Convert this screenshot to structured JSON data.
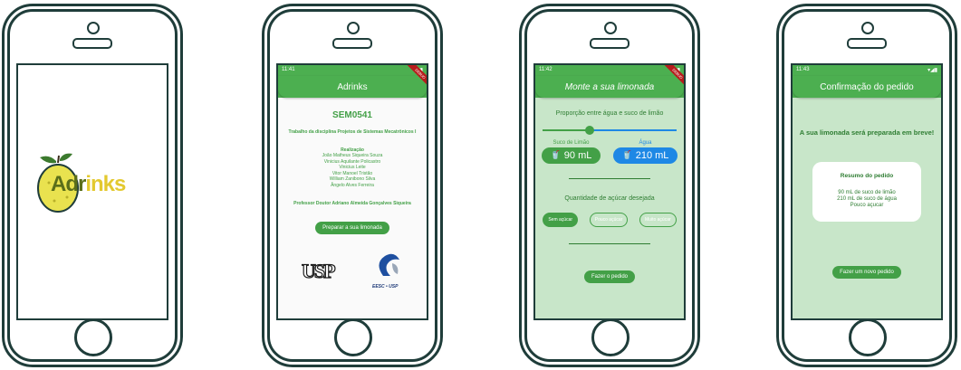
{
  "splash": {
    "logo_prefix": "Adr",
    "logo_suffix": "inks"
  },
  "home": {
    "status_time": "11:41",
    "app_title": "Adrinks",
    "debug_banner": "DEBUG",
    "course_code": "SEM0541",
    "subtitle": "Trabalho da disciplina Projetos de Sistemas Mecatrônicos I",
    "realization_label": "Realização",
    "authors": [
      "João Matheus Siqueira Souza",
      "Vinicius Aquilante Policastro",
      "Vinicius Leite",
      "Vitor Manoel Tristão",
      "William Zanibono Silva",
      "Ângelo Alves Ferreira"
    ],
    "professor": "Professor Doutor Adriano Almeida Gonçalves Siqueira",
    "cta_label": "Preparar a sua limonada",
    "logo_usp": "USP",
    "logo_eesc": "EESC • USP"
  },
  "config": {
    "status_time": "11:42",
    "app_title": "Monte a sua limonada",
    "proportion_label": "Proporção entre água e suco de limão",
    "slider_value": 0.35,
    "lemon_label": "Suco de Limão",
    "lemon_value": "90 mL",
    "water_label": "Água",
    "water_value": "210 mL",
    "sugar_label": "Quantidade de açúcar desejada",
    "sugar_options": [
      "Sem açúcar",
      "Pouco açúcar",
      "Muito açúcar"
    ],
    "submit_label": "Fazer o pedido",
    "colors": {
      "green": "#43a047",
      "blue": "#1e88e5"
    }
  },
  "confirm": {
    "status_time": "11:43",
    "app_title": "Confirmação do pedido",
    "message": "A sua limonada será preparada em breve!",
    "summary_title": "Resumo do pedido",
    "summary_lines": [
      "90 mL de suco de limão",
      "210 mL de suco de água",
      "Pouco açucar"
    ],
    "new_order_label": "Fazer um novo pedido"
  }
}
